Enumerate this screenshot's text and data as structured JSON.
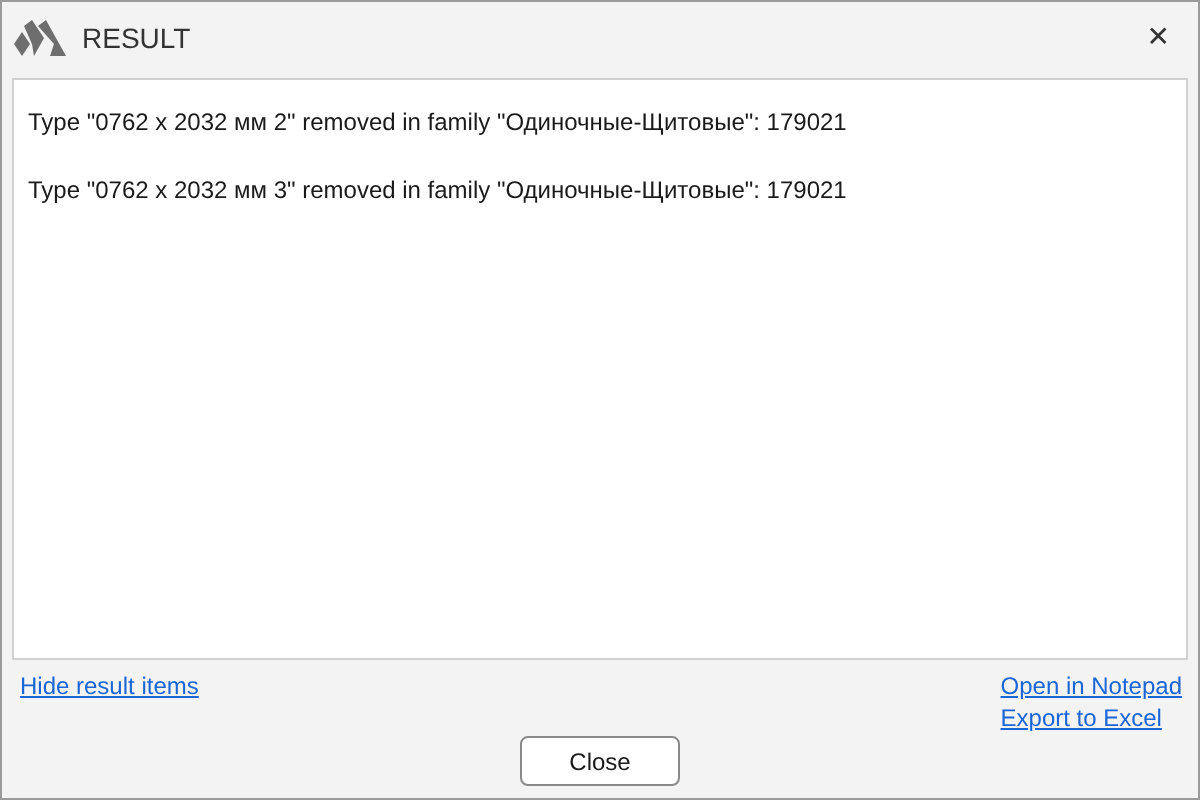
{
  "window": {
    "title": "RESULT",
    "close_glyph": "✕"
  },
  "messages": [
    "Type \"0762 x 2032 мм 2\" removed in family \"Одиночные-Щитовые\": 179021",
    "Type \"0762 x 2032 мм 3\" removed in family \"Одиночные-Щитовые\": 179021"
  ],
  "links_left": [
    "Hide result items"
  ],
  "links_right": [
    "Open in Notepad",
    "Export to Excel"
  ],
  "buttons": [
    "Close"
  ]
}
